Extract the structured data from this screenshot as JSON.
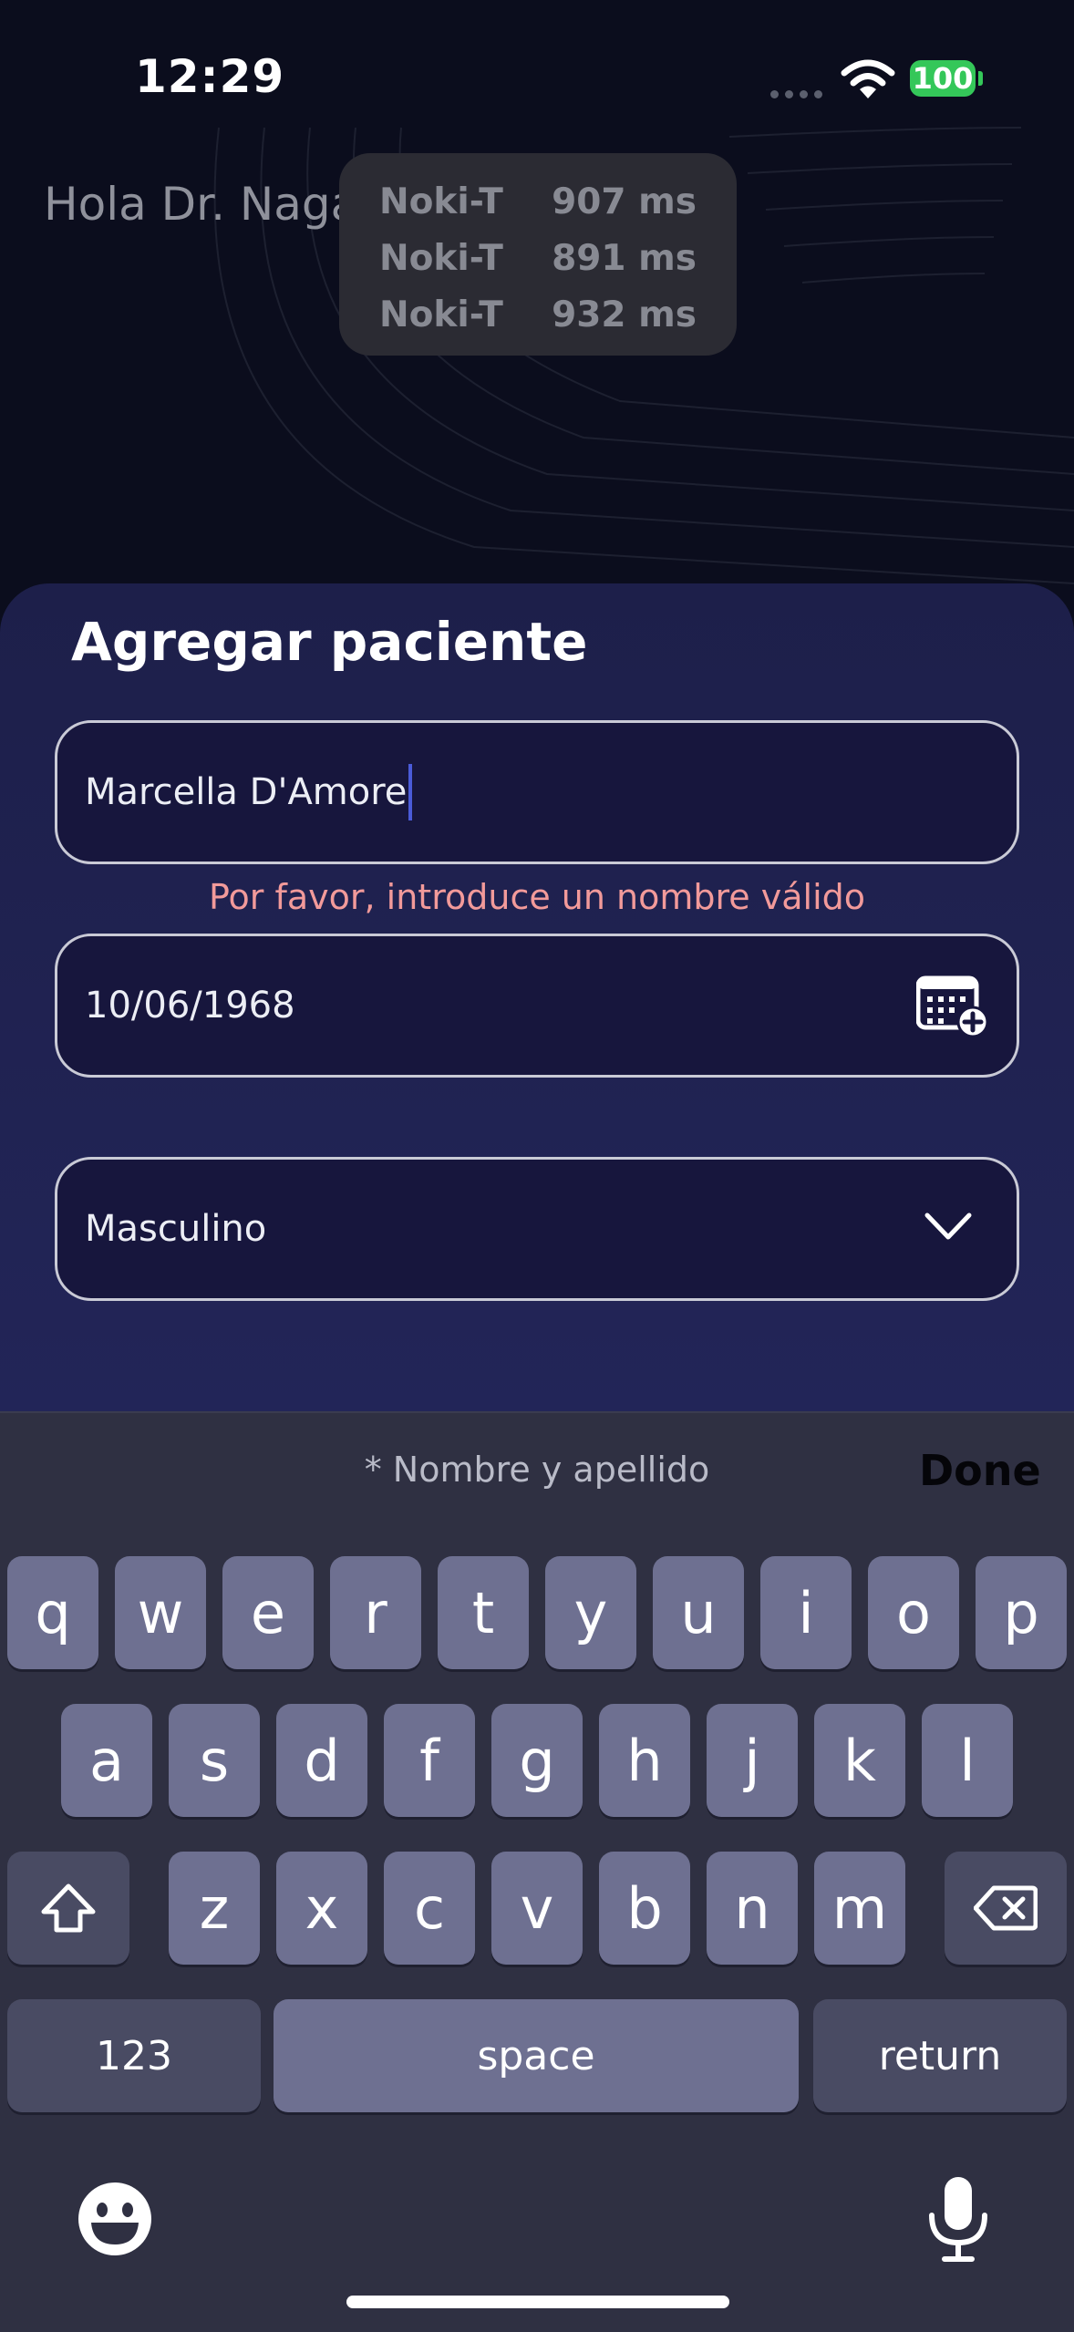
{
  "status_bar": {
    "time": "12:29",
    "battery": "100"
  },
  "background": {
    "greeting": "Hola Dr. Naga",
    "latency": [
      {
        "label": "Noki-T",
        "value": "907 ms"
      },
      {
        "label": "Noki-T",
        "value": "891 ms"
      },
      {
        "label": "Noki-T",
        "value": "932 ms"
      }
    ]
  },
  "sheet": {
    "title": "Agregar paciente",
    "name_value": "Marcella D'Amore",
    "name_error": "Por favor, introduce un nombre válido",
    "birthdate_value": "10/06/1968",
    "gender_value": "Masculino"
  },
  "keyboard": {
    "hint": "* Nombre y apellido",
    "done_label": "Done",
    "row1": [
      "q",
      "w",
      "e",
      "r",
      "t",
      "y",
      "u",
      "i",
      "o",
      "p"
    ],
    "row2": [
      "a",
      "s",
      "d",
      "f",
      "g",
      "h",
      "j",
      "k",
      "l"
    ],
    "row3": [
      "z",
      "x",
      "c",
      "v",
      "b",
      "n",
      "m"
    ],
    "numbers_label": "123",
    "space_label": "space",
    "return_label": "return"
  }
}
